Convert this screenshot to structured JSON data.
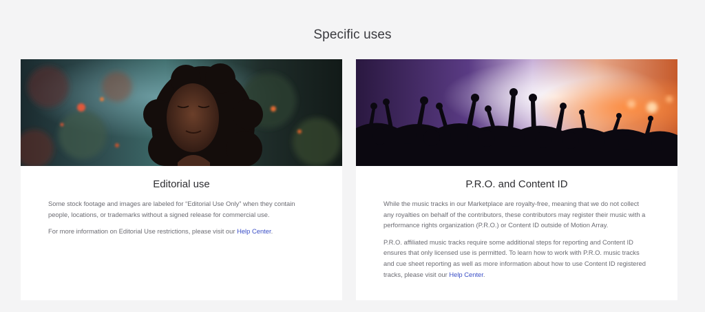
{
  "section": {
    "title": "Specific uses"
  },
  "cards": [
    {
      "title": "Editorial use",
      "image_alt": "Woman with curly hair and closed eyes in front of blurred foliage",
      "paragraphs": [
        "Some stock footage and images are labeled for “Editorial Use Only” when they contain people, locations, or trademarks without a signed release for commercial use."
      ],
      "link_paragraph": {
        "before": "For more information on Editorial Use restrictions, please visit our ",
        "link": "Help Center",
        "after": "."
      }
    },
    {
      "title": "P.R.O. and Content ID",
      "image_alt": "Concert crowd with raised hands silhouetted against stage lights",
      "paragraphs": [
        "While the music tracks in our Marketplace are royalty-free, meaning that we do not collect any royalties on behalf of the contributors, these contributors may register their music with a performance rights organization (P.R.O.) or Content ID outside of Motion Array."
      ],
      "link_paragraph": {
        "before": "P.R.O. affiliated music tracks require some additional steps for reporting and Content ID ensures that only licensed use is permitted. To learn how to work with P.R.O. music tracks and cue sheet reporting as well as more information about how to use Content ID registered tracks, please visit our ",
        "link": "Help Center",
        "after": "."
      }
    }
  ],
  "colors": {
    "background": "#f4f4f5",
    "card": "#ffffff",
    "link": "#3a4ec6",
    "body_text": "#6b6b72",
    "title_text": "#2c2c30"
  }
}
